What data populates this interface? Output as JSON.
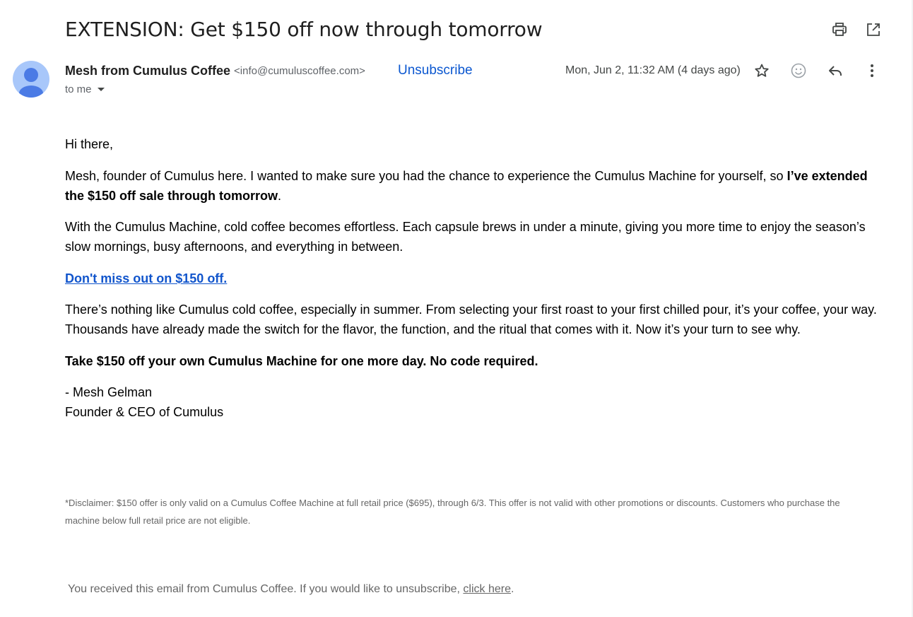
{
  "email": {
    "subject": "EXTENSION: Get $150 off now through tomorrow",
    "sender_name": "Mesh from Cumulus Coffee",
    "sender_email": "<info@cumuluscoffee.com>",
    "unsubscribe_label": "Unsubscribe",
    "recipient_label": "to me",
    "date": "Mon, Jun 2, 11:32 AM (4 days ago)"
  },
  "icons": {
    "print": "print-icon",
    "open_new_window": "open-in-new-window-icon",
    "star": "star-icon",
    "emoji": "emoji-reaction-icon",
    "reply": "reply-icon",
    "more": "more-vert-icon",
    "avatar": "default-avatar-icon"
  },
  "colors": {
    "link_blue": "#1155cc",
    "unsubscribe_blue": "#0b57d0",
    "avatar_bg": "#a8c7fa",
    "avatar_fg": "#4b7be5",
    "muted_text": "#666666"
  },
  "body": {
    "greeting": "Hi there,",
    "p1_text": "Mesh, founder of Cumulus here. I wanted to make sure you had the chance to experience the Cumulus Machine for yourself, so ",
    "p1_bold": "I’ve extended the $150 off sale through tomorrow",
    "p1_end": ".",
    "p2": "With the Cumulus Machine, cold coffee becomes effortless. Each capsule brews in under a minute, giving you more time to enjoy the season’s slow mornings, busy afternoons, and everything in between.",
    "cta_link": "Don't miss out on $150 off.",
    "p3": "There’s nothing like Cumulus cold coffee, especially in summer. From selecting your first roast to your first chilled pour, it’s your coffee, your way. Thousands have already made the switch for the flavor, the function, and the ritual that comes with it. Now it’s your turn to see why.",
    "p4_bold": "Take $150 off your own Cumulus Machine for one more day. No code required.",
    "signature_name": "- Mesh Gelman",
    "signature_title": "Founder & CEO of Cumulus"
  },
  "disclaimer": "*Disclaimer: $150 offer is only valid on a Cumulus Coffee Machine at full retail price ($695), through 6/3. This offer is not valid with other promotions or discounts. Customers who purchase the machine below full retail price are not eligible.",
  "footer": {
    "text": "You received this email from Cumulus Coffee. If you would like to unsubscribe, ",
    "link": "click here",
    "end": "."
  }
}
